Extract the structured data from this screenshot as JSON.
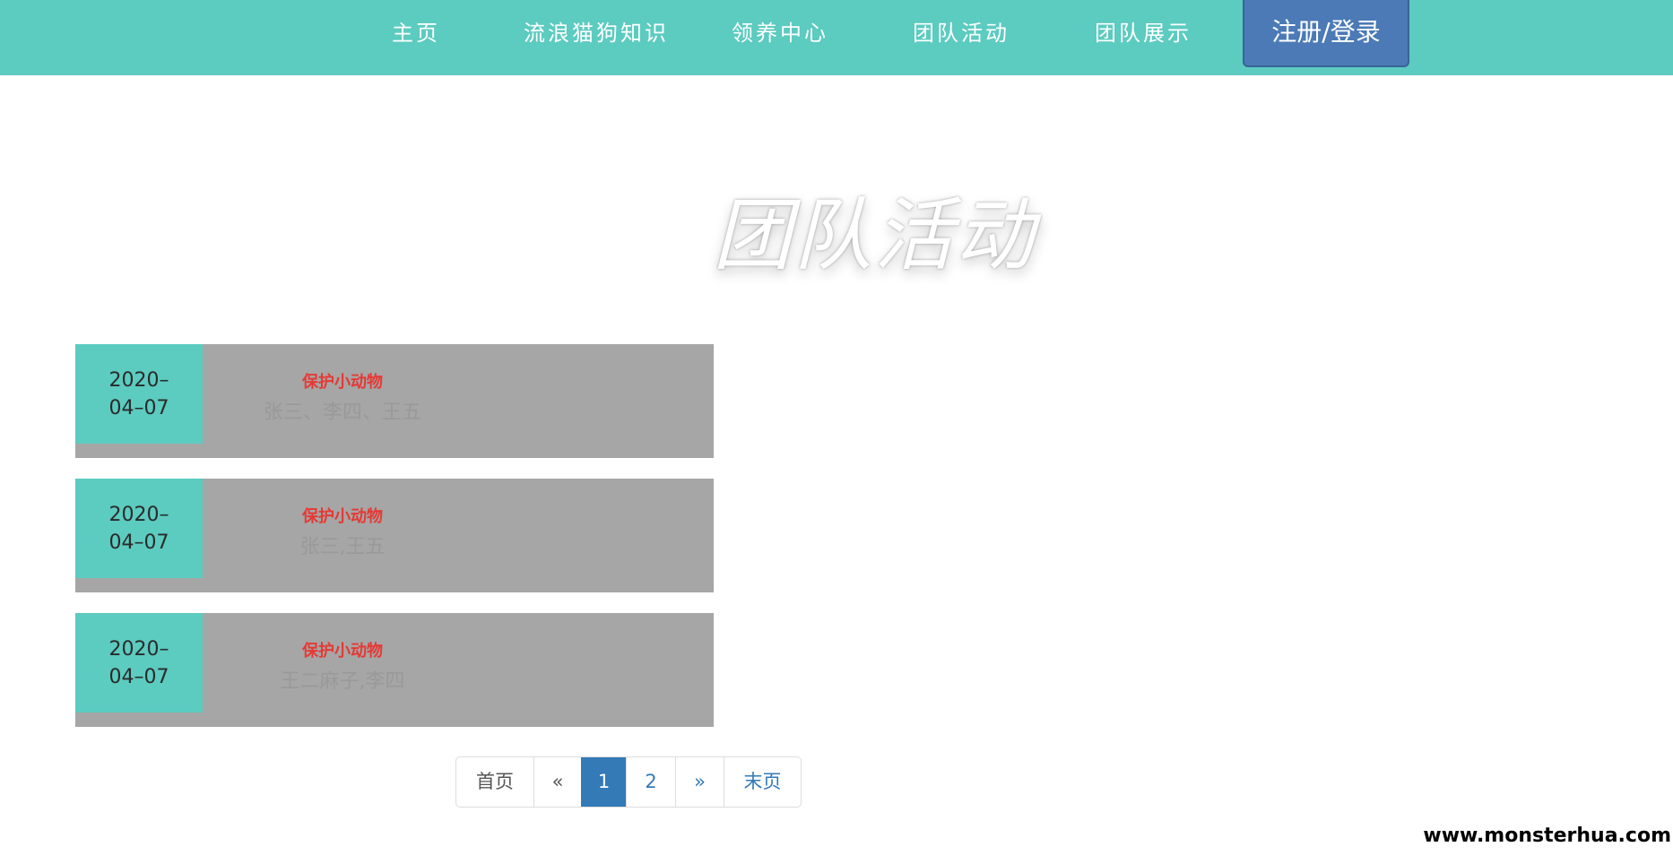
{
  "nav": {
    "items": [
      {
        "label": "主页"
      },
      {
        "label": "流浪猫狗知识"
      },
      {
        "label": "领养中心"
      },
      {
        "label": "团队活动"
      },
      {
        "label": "团队展示"
      }
    ],
    "login_label": "注册/登录"
  },
  "page_title": "团队活动",
  "activities": [
    {
      "date_line1": "2020–",
      "date_line2": "04–07",
      "title": "保护小动物",
      "members": "张三、李四、王五"
    },
    {
      "date_line1": "2020–",
      "date_line2": "04–07",
      "title": "保护小动物",
      "members": "张三,王五"
    },
    {
      "date_line1": "2020–",
      "date_line2": "04–07",
      "title": "保护小动物",
      "members": "王二麻子,李四"
    }
  ],
  "pagination": {
    "first": "首页",
    "prev": "«",
    "pages": [
      "1",
      "2"
    ],
    "current_page": "1",
    "next": "»",
    "last": "末页"
  },
  "watermark": "www.monsterhua.com",
  "colors": {
    "nav_bg": "#5ccbc0",
    "login_bg": "#4b7ab6",
    "card_bg": "#a6a6a6",
    "date_bg": "#5ccbc0",
    "activity_title": "#e53935",
    "pagination_active": "#337ab7"
  }
}
